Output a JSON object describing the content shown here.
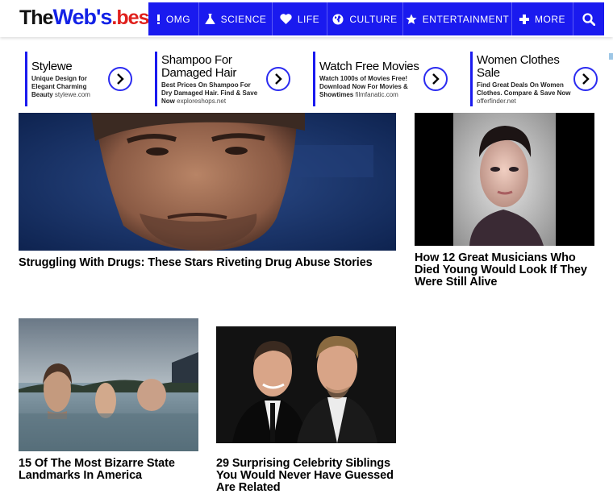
{
  "header": {
    "logo": {
      "part1": "The",
      "part2": "Web's",
      "part3": ".best"
    },
    "nav": [
      {
        "label": "OMG",
        "icon": "exclamation-icon"
      },
      {
        "label": "SCIENCE",
        "icon": "flask-icon"
      },
      {
        "label": "LIFE",
        "icon": "heart-icon"
      },
      {
        "label": "CULTURE",
        "icon": "globe-icon"
      },
      {
        "label": "ENTERTAINMENT",
        "icon": "star-icon"
      },
      {
        "label": "MORE",
        "icon": "plus-icon"
      }
    ],
    "search_icon": "search-icon"
  },
  "ads": [
    {
      "title": "Stylewe",
      "desc": "Unique Design for Elegant Charming Beauty",
      "url": "stylewe.com"
    },
    {
      "title": "Shampoo For Damaged Hair",
      "desc": "Best Prices On Shampoo For Dry Damaged Hair. Find & Save Now",
      "url": "exploreshops.net"
    },
    {
      "title": "Watch Free Movies",
      "desc": "Watch 1000s of Movies Free! Download Now For Movies & Showtimes",
      "url": "filmfanatic.com"
    },
    {
      "title": "Women Clothes Sale",
      "desc": "Find Great Deals On Women Clothes. Compare & Save Now",
      "url": "offerfinder.net"
    }
  ],
  "articles": [
    {
      "title": "Struggling With Drugs: These Stars Riveting Drug Abuse Stories"
    },
    {
      "title": "How 12 Great Musicians Who Died Young Would Look If They Were Still Alive"
    },
    {
      "title": "15 Of The Most Bizarre State Landmarks In America"
    },
    {
      "title": "29 Surprising Celebrity Siblings You Would Never Have Guessed Are Related"
    }
  ],
  "colors": {
    "nav_blue": "#1a1aef",
    "logo_blue": "#1322e6",
    "logo_red": "#e0201c"
  }
}
